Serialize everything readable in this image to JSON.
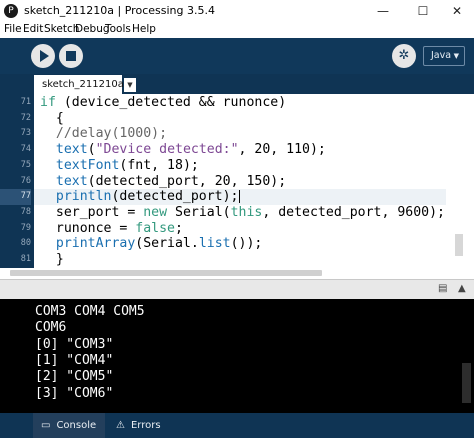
{
  "window": {
    "title": "sketch_211210a | Processing 3.5.4",
    "app_icon": "processing-logo-icon",
    "app_icon_glyph": "P",
    "controls": {
      "minimize": "—",
      "maximize": "☐",
      "close": "✕"
    }
  },
  "menu": [
    "File",
    "Edit",
    "Sketch",
    "Debug",
    "Tools",
    "Help"
  ],
  "toolbar": {
    "run_icon": "play-icon",
    "stop_icon": "stop-icon",
    "debug_icon": "butterfly-icon",
    "debug_glyph": "✲",
    "mode_label": "Java",
    "mode_caret": "▼"
  },
  "tabs": {
    "active": "sketch_211210a",
    "menu_arrow": "▼"
  },
  "editor": {
    "line_numbers": [
      "71",
      "72",
      "73",
      "74",
      "75",
      "76",
      "77",
      "78",
      "79",
      "80",
      "81"
    ],
    "current_line_index": 6,
    "lines": [
      {
        "indent": "",
        "parts": [
          {
            "t": "if",
            "c": "kw-green"
          },
          {
            "t": " (device_detected && runonce)",
            "c": ""
          }
        ]
      },
      {
        "indent": "  ",
        "parts": [
          {
            "t": "{",
            "c": ""
          }
        ]
      },
      {
        "indent": "  ",
        "parts": [
          {
            "t": "//delay(1000);",
            "c": "kw-cmt"
          }
        ]
      },
      {
        "indent": "  ",
        "parts": [
          {
            "t": "text",
            "c": "kw-blue"
          },
          {
            "t": "(",
            "c": ""
          },
          {
            "t": "\"Device detected:\"",
            "c": "kw-str"
          },
          {
            "t": ", 20, 110);",
            "c": ""
          }
        ]
      },
      {
        "indent": "  ",
        "parts": [
          {
            "t": "textFont",
            "c": "kw-blue"
          },
          {
            "t": "(fnt, 18);",
            "c": ""
          }
        ]
      },
      {
        "indent": "  ",
        "parts": [
          {
            "t": "text",
            "c": "kw-blue"
          },
          {
            "t": "(detected_port, 20, 150);",
            "c": ""
          }
        ]
      },
      {
        "indent": "  ",
        "parts": [
          {
            "t": "println",
            "c": "kw-blue"
          },
          {
            "t": "(detected_port);",
            "c": ""
          }
        ]
      },
      {
        "indent": "  ",
        "parts": [
          {
            "t": "ser_port = ",
            "c": ""
          },
          {
            "t": "new",
            "c": "kw-green"
          },
          {
            "t": " Serial(",
            "c": ""
          },
          {
            "t": "this",
            "c": "kw-green"
          },
          {
            "t": ", detected_port, 9600);",
            "c": ""
          }
        ]
      },
      {
        "indent": "  ",
        "parts": [
          {
            "t": "runonce = ",
            "c": ""
          },
          {
            "t": "false",
            "c": "kw-green"
          },
          {
            "t": ";",
            "c": ""
          }
        ]
      },
      {
        "indent": "  ",
        "parts": [
          {
            "t": "printArray",
            "c": "kw-blue"
          },
          {
            "t": "(Serial.",
            "c": ""
          },
          {
            "t": "list",
            "c": "kw-blue"
          },
          {
            "t": "());",
            "c": ""
          }
        ]
      },
      {
        "indent": "  ",
        "parts": [
          {
            "t": "}",
            "c": ""
          }
        ]
      }
    ]
  },
  "console_header": {
    "copy_icon": "copy-icon",
    "copy_glyph": "▤",
    "collapse_icon": "collapse-icon",
    "collapse_glyph": "▲"
  },
  "console": {
    "lines": [
      "COM3 COM4 COM5",
      "COM6",
      "[0] \"COM3\"",
      "[1] \"COM4\"",
      "[2] \"COM5\"",
      "[3] \"COM6\""
    ]
  },
  "bottom_tabs": [
    {
      "label": "Console",
      "icon": "console-icon",
      "glyph": "▭",
      "active": true
    },
    {
      "label": "Errors",
      "icon": "warning-icon",
      "glyph": "⚠",
      "active": false
    }
  ]
}
